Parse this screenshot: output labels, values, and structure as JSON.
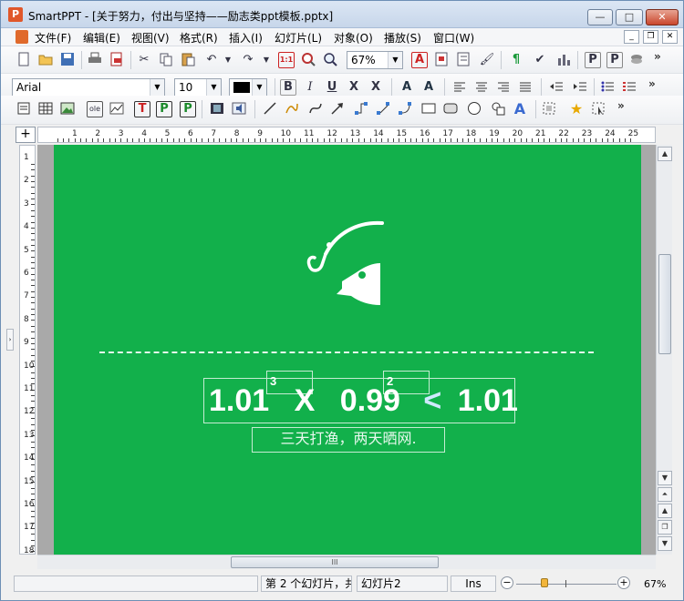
{
  "window": {
    "app_icon": "P",
    "title": "SmartPPT - [关于努力，付出与坚持——励志类ppt模板.pptx]",
    "buttons": {
      "minimize": "—",
      "maximize": "□",
      "close": "✕"
    }
  },
  "menu": {
    "items": [
      "文件(F)",
      "编辑(E)",
      "视图(V)",
      "格式(R)",
      "插入(I)",
      "幻灯片(L)",
      "对象(O)",
      "播放(S)",
      "窗口(W)"
    ],
    "mdi": {
      "minimize": "_",
      "restore": "❐",
      "close": "✕"
    }
  },
  "toolbar1": {
    "zoom_value": "67%",
    "icons": [
      "new-icon",
      "open-icon",
      "save-icon",
      "print-icon",
      "export-pdf-icon",
      "cut-icon",
      "copy-icon",
      "paste-icon",
      "undo-icon",
      "redo-icon",
      "actual-size-icon",
      "zoom-area-icon",
      "zoom-icon",
      "text-color-icon",
      "find-replace-icon",
      "list-icon",
      "format-painter-icon",
      "paragraph-mark-icon",
      "spellcheck-icon",
      "chart-icon",
      "slide-view-icon",
      "notes-view-icon",
      "layers-icon"
    ]
  },
  "toolbar2": {
    "font": "Arial",
    "size": "10",
    "color_swatch": "#000000",
    "labels": {
      "bold": "B",
      "italic": "I",
      "underline": "U",
      "strike": "X",
      "superscript": "X",
      "grow": "A",
      "shrink": "A"
    }
  },
  "ruler": {
    "h": [
      "1",
      "2",
      "3",
      "4",
      "5",
      "6",
      "7",
      "8",
      "9",
      "10",
      "11",
      "12",
      "13",
      "14",
      "15",
      "16",
      "17",
      "18",
      "19",
      "20",
      "21",
      "22",
      "23",
      "24",
      "25"
    ],
    "v": [
      "1",
      "2",
      "3",
      "4",
      "5",
      "6",
      "7",
      "8",
      "9",
      "10",
      "11",
      "12",
      "13",
      "14",
      "15",
      "16",
      "17",
      "18"
    ]
  },
  "slide": {
    "background": "#12b04b",
    "equation": {
      "left": "1.01",
      "op1": "X",
      "mid": "0.99",
      "op2": "<",
      "right": "1.01"
    },
    "exp1": "3",
    "exp2": "2",
    "subtitle": "三天打渔，两天晒网."
  },
  "hscroll": {
    "thumb_label": "III"
  },
  "status": {
    "slide_info": "第 2 个幻灯片，共",
    "slide_name": "幻灯片2",
    "mode": "Ins",
    "zoom_minus": "−",
    "zoom_plus": "+",
    "zoom_level": "67%"
  }
}
